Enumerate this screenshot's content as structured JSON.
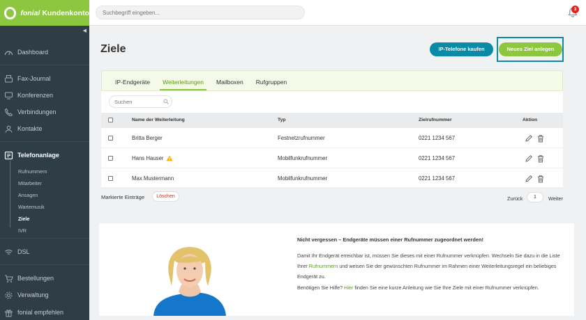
{
  "brand": {
    "name": "fonial",
    "suffix": "Kundenkonto",
    "color": "#8dc63f"
  },
  "topbar": {
    "search_placeholder": "Suchbegriff eingeben...",
    "notification_count": "3"
  },
  "sidebar": {
    "items": [
      {
        "label": "Dashboard",
        "icon": "dashboard-icon"
      },
      {
        "label": "Fax-Journal",
        "icon": "fax-icon"
      },
      {
        "label": "Konferenzen",
        "icon": "conference-icon"
      },
      {
        "label": "Verbindungen",
        "icon": "phone-icon"
      },
      {
        "label": "Kontakte",
        "icon": "contacts-icon"
      },
      {
        "label": "Telefonanlage",
        "icon": "pbx-icon"
      },
      {
        "label": "DSL",
        "icon": "wifi-icon"
      },
      {
        "label": "Bestellungen",
        "icon": "cart-icon"
      },
      {
        "label": "Verwaltung",
        "icon": "gear-icon"
      },
      {
        "label": "fonial empfehlen",
        "icon": "recommend-icon"
      }
    ],
    "subitems": [
      "Rufnummern",
      "Mitarbeiter",
      "Ansagen",
      "Wartemusik",
      "Ziele",
      "IVR"
    ]
  },
  "page": {
    "title": "Ziele",
    "btn_ip": "IP-Telefone kaufen",
    "btn_new": "Neues Ziel anlegen"
  },
  "tabs": [
    "IP-Endgeräte",
    "Weiterleitungen",
    "Mailboxen",
    "Rufgruppen"
  ],
  "table": {
    "search_placeholder": "Suchen",
    "columns": [
      "Name der Weiterleitung",
      "Typ",
      "Zielrufnummer",
      "Aktion"
    ],
    "rows": [
      {
        "name": "Britta Berger",
        "type": "Festnetzrufnummer",
        "target": "0221 1234 567"
      },
      {
        "name": "Hans Hauser",
        "type": "Mobilfunkrufnummer",
        "target": "0221 1234 567"
      },
      {
        "name": "Max Mustermann",
        "type": "Mobilfunkrufnummer",
        "target": "0221 1234 567"
      }
    ],
    "marked_label": "Markierte Einträge",
    "delete_label": "Löschen",
    "prev": "Zurück",
    "page": "1",
    "next": "Weiter"
  },
  "hint": {
    "title": "Nicht vergessen – Endgeräte müssen einer Rufnummer zugeordnet werden!",
    "p1_a": "Damit Ihr Endgerät erreichbar ist, müssen Sie dieses mit einer Rufnummer verknüpfen. Wechseln Sie dazu in die Liste Ihrer ",
    "p1_link": "Rufnummern",
    "p1_b": " und weisen Sie der gewünschten Rufnummer im Rahmen einer Weiterleitungsregel ein beliebiges Endgerät zu.",
    "p2_a": "Benötigen Sie Hilfe? ",
    "p2_link": "Hier",
    "p2_b": " finden Sie eine kurze Anleitung wie Sie Ihre Ziele mit einer Rufnummer verknüpfen."
  }
}
